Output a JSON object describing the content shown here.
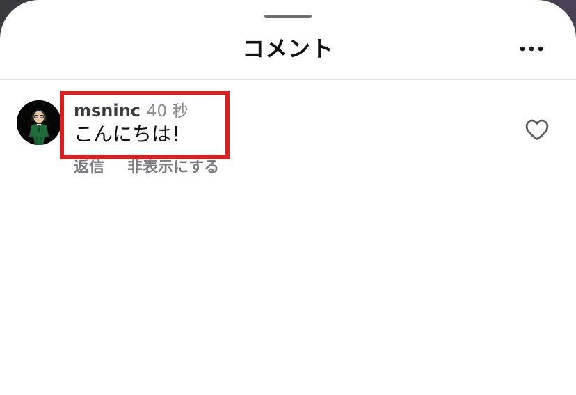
{
  "sheet": {
    "title": "コメント",
    "more_icon": "more-horizontal-icon"
  },
  "comment": {
    "username": "msninc",
    "time": "40 秒",
    "text": "こんにちは！",
    "actions": {
      "reply": "返信",
      "hide": "非表示にする"
    },
    "like_icon": "heart-outline-icon",
    "avatar_icon": "avatar-illustration"
  },
  "colors": {
    "highlight": "#d9201e",
    "text_primary": "#111111",
    "text_secondary": "#8a8a8f",
    "divider": "#e3e3e6"
  }
}
